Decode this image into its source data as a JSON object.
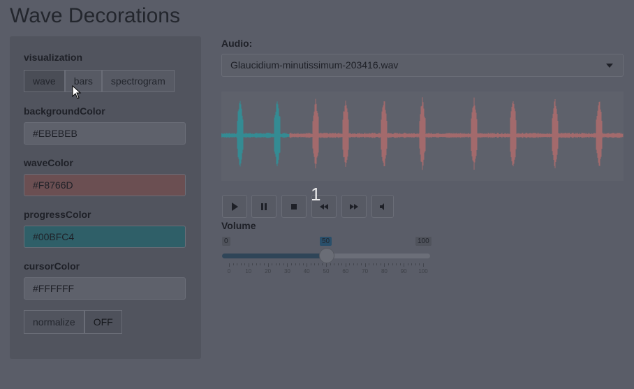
{
  "title": "Wave Decorations",
  "sidebar": {
    "visualization_label": "visualization",
    "visualization_options": [
      "wave",
      "bars",
      "spectrogram"
    ],
    "visualization_selected": "wave",
    "background_color_label": "backgroundColor",
    "background_color_value": "#EBEBEB",
    "wave_color_label": "waveColor",
    "wave_color_value": "#F8766D",
    "progress_color_label": "progressColor",
    "progress_color_value": "#00BFC4",
    "cursor_color_label": "cursorColor",
    "cursor_color_value": "#FFFFFF",
    "normalize_label": "normalize",
    "normalize_state": "OFF"
  },
  "audio": {
    "label": "Audio:",
    "selected_file": "Glaucidium-minutissimum-203416.wav"
  },
  "waveform": {
    "wave_color": "#F8766D",
    "progress_color": "#00BFC4",
    "progress_fraction": 0.17
  },
  "controls": {
    "buttons": [
      "play-icon",
      "pause-icon",
      "stop-icon",
      "rewind-icon",
      "fast-forward-icon",
      "mute-icon"
    ],
    "counter": "1"
  },
  "volume": {
    "label": "Volume",
    "min": "0",
    "max": "100",
    "value": "50",
    "value_number": 50,
    "tick_labels": [
      "0",
      "10",
      "20",
      "30",
      "40",
      "50",
      "60",
      "70",
      "80",
      "90",
      "100"
    ]
  }
}
